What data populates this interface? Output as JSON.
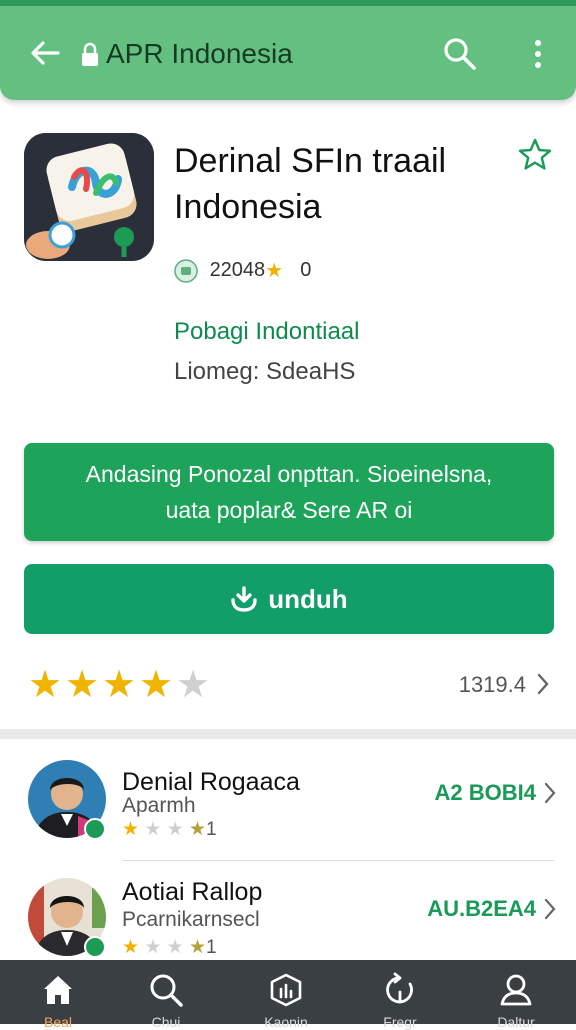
{
  "appbar": {
    "title": "APR Indonesia",
    "icons": [
      "back-arrow-icon",
      "lock-icon",
      "search-icon",
      "more-vert-icon"
    ]
  },
  "app": {
    "title_line1": "Derinal SFIn traail",
    "title_line2": "Indonesia",
    "downloads": "22048",
    "rating_small": "0",
    "developer": "Pobagi Indontiaal",
    "license": "Liomeg: SdeaHS"
  },
  "promo": {
    "line1": "Andasing Ponozal  onpttan. Sioeinelsna,",
    "line2": "uata poplar& Sere AR oi"
  },
  "download": {
    "label": "unduh"
  },
  "rating": {
    "stars": 4,
    "max": 5,
    "count": "1319.4"
  },
  "reviews": [
    {
      "name": "Denial Rogaaca",
      "subtitle": "Aparmh",
      "suffix": "1",
      "points": "A2 BOBI4"
    },
    {
      "name": "Aotiai Rallop",
      "subtitle": "Pcarnikarnsecl",
      "suffix": "1",
      "points": "AU.B2EA4"
    }
  ],
  "bottom_nav": [
    {
      "label": "Beal",
      "icon": "home-icon",
      "active": true
    },
    {
      "label": "Chui",
      "icon": "search-icon",
      "active": false
    },
    {
      "label": "Kaonin",
      "icon": "apps-icon",
      "active": false
    },
    {
      "label": "Fregr",
      "icon": "refresh-icon",
      "active": false
    },
    {
      "label": "Daltur",
      "icon": "profile-icon",
      "active": false
    }
  ],
  "colors": {
    "appbar": "#64c081",
    "accent": "#1ea35a",
    "download_button": "#129e68",
    "star": "#f0b400",
    "nav_bg": "#3a3f44"
  }
}
